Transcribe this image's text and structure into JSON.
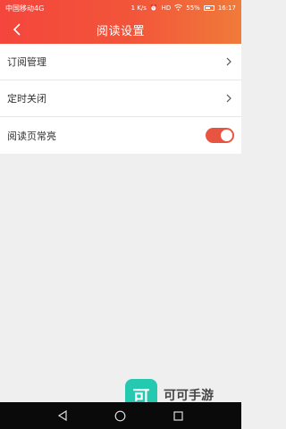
{
  "status": {
    "carrier": "中国移动4G",
    "net_speed": "1 K/s",
    "battery_percent": "55%",
    "time": "16:17",
    "hd_label": "HD",
    "battery_level": 0.55,
    "icons": [
      "alarm-icon",
      "volte-icon",
      "wifi-icon",
      "battery-icon"
    ]
  },
  "header": {
    "title": "阅读设置",
    "back_icon": "chevron-left-icon",
    "colors": {
      "gradient_start": "#f4463c",
      "gradient_end": "#f07b3a"
    }
  },
  "settings": {
    "items": [
      {
        "label": "订阅管理",
        "control": "chevron-right-icon"
      },
      {
        "label": "定时关闭",
        "control": "chevron-right-icon"
      },
      {
        "label": "阅读页常亮",
        "control": "toggle",
        "enabled": true
      }
    ],
    "toggle_color": "#e75441"
  },
  "watermark": {
    "logo_char": "可",
    "text": "可可手游",
    "logo_color": "#24c9b0"
  },
  "nav": {
    "buttons": [
      "back-triangle-icon",
      "home-circle-icon",
      "recents-square-icon"
    ]
  }
}
